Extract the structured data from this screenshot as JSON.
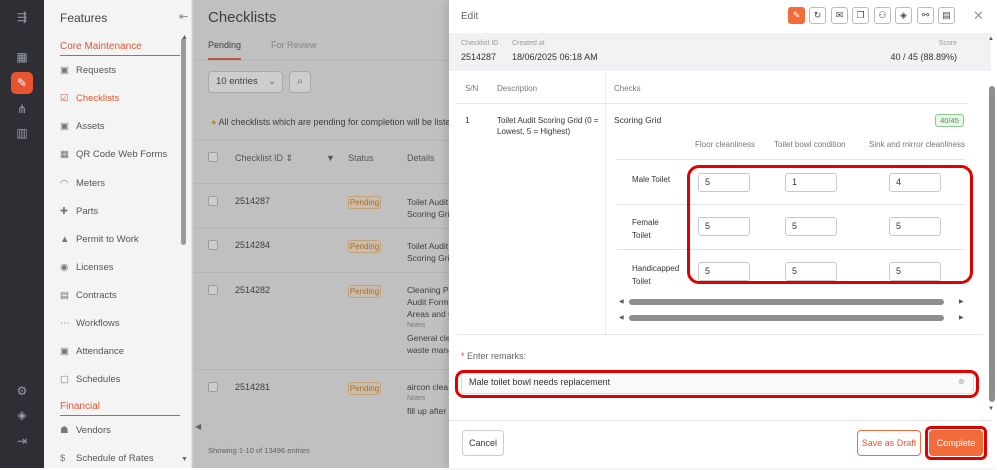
{
  "rail": {
    "icons": [
      "menu-icon",
      "grid-icon",
      "tools-icon",
      "branch-icon",
      "analytics-icon",
      "settings-icon",
      "cube-icon",
      "logout-icon"
    ]
  },
  "sidebar": {
    "title": "Features",
    "groups": [
      {
        "label": "Core Maintenance"
      },
      {
        "label": "Financial"
      }
    ],
    "items": [
      {
        "label": "Requests"
      },
      {
        "label": "Checklists"
      },
      {
        "label": "Assets"
      },
      {
        "label": "QR Code Web Forms"
      },
      {
        "label": "Meters"
      },
      {
        "label": "Parts"
      },
      {
        "label": "Permit to Work"
      },
      {
        "label": "Licenses"
      },
      {
        "label": "Contracts"
      },
      {
        "label": "Workflows"
      },
      {
        "label": "Attendance"
      },
      {
        "label": "Schedules"
      },
      {
        "label": "Vendors"
      },
      {
        "label": "Schedule of Rates"
      }
    ]
  },
  "main": {
    "title": "Checklists",
    "tabs": [
      {
        "label": "Pending"
      },
      {
        "label": "For Review"
      }
    ],
    "entries": "10 entries",
    "notice": "All checklists which are pending for completion will be listed he",
    "columns": [
      "Checklist ID",
      "Status",
      "Details"
    ],
    "rows": [
      {
        "id": "2514287",
        "status": "Pending",
        "details": [
          "Toilet Audit",
          "Scoring Gri"
        ]
      },
      {
        "id": "2514284",
        "status": "Pending",
        "details": [
          "Toilet Audit",
          "Scoring Gri"
        ]
      },
      {
        "id": "2514282",
        "status": "Pending",
        "details": [
          "Cleaning Pa",
          "Audit Form",
          "Areas and C",
          "Notes",
          "General cle",
          "waste mana"
        ]
      },
      {
        "id": "2514281",
        "status": "Pending",
        "details": [
          "aircon clea",
          "Notes",
          "fill up after"
        ]
      }
    ],
    "footer": "Showing 1-10 of 13496 entries"
  },
  "panel": {
    "title": "Edit",
    "toolbar_icons": [
      "pencil-icon",
      "history-icon",
      "mail-icon",
      "copy-icon",
      "users-icon",
      "box-icon",
      "link-icon",
      "pdf-icon"
    ],
    "meta": {
      "id_label": "Checklist ID",
      "id": "2514287",
      "created_label": "Created at",
      "created": "18/06/2025 06:18 AM",
      "score_label": "Score",
      "score": "40 / 45 (88.89%)"
    },
    "columns": {
      "sn": "S/N",
      "description": "Description",
      "checks": "Checks"
    },
    "item": {
      "sn": "1",
      "description": "Toilet Audit Scoring Grid (0 = Lowest, 5 = Highest)",
      "check_title": "Scoring Grid",
      "badge": "40/45",
      "grid_columns": [
        "Floor cleanliness",
        "Toilet bowl condition",
        "Sink and mirror cleanliness"
      ],
      "grid_rows": [
        {
          "label": "Male Toilet",
          "values": [
            "5",
            "1",
            "4"
          ]
        },
        {
          "label": "Female Toilet",
          "values": [
            "5",
            "5",
            "5"
          ]
        },
        {
          "label": "Handicapped Toilet",
          "values": [
            "5",
            "5",
            "5"
          ]
        }
      ]
    },
    "remarks_label": "Enter remarks:",
    "remarks_required": "*",
    "remarks_value": "Male toilet bowl needs replacement",
    "buttons": {
      "cancel": "Cancel",
      "save_draft": "Save as Draft",
      "complete": "Complete"
    },
    "colors": {
      "accent": "#f26b3a",
      "highlight": "#e00000",
      "badge_green": "#4caf50"
    }
  }
}
